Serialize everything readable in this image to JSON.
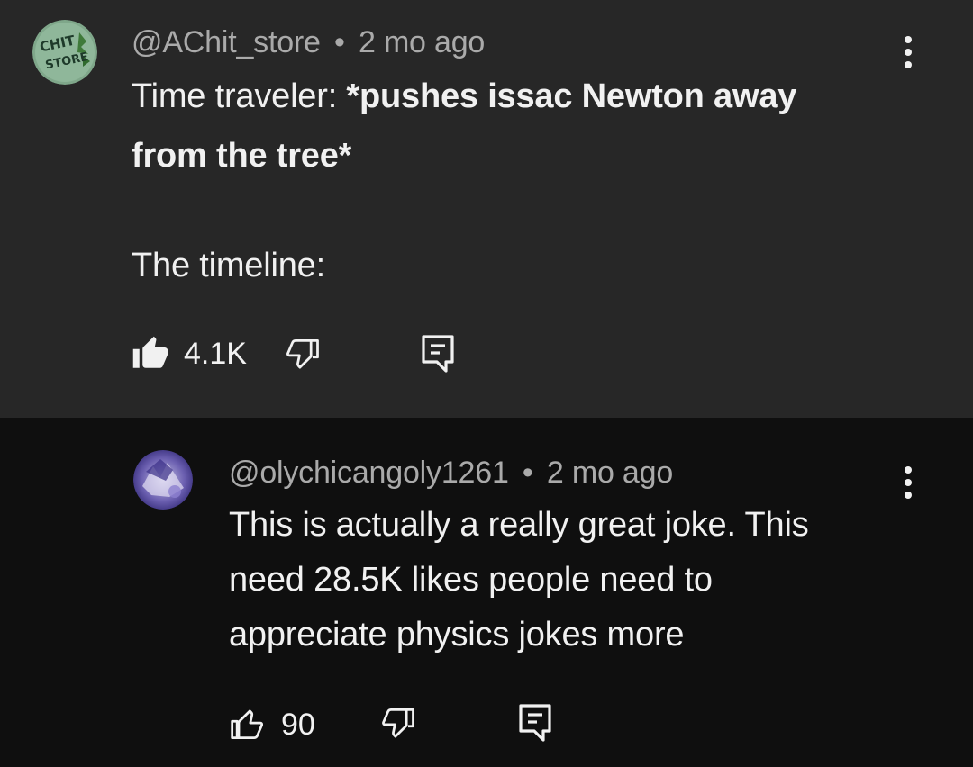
{
  "comments": [
    {
      "author": "@AChit_store",
      "separator": "•",
      "time": "2 mo ago",
      "avatar_text_line1": "CHIT",
      "avatar_text_line2": "STORE",
      "text_line1_plain": "Time traveler: ",
      "text_line1_bold": "*pushes issac Newton away",
      "text_line2_bold": "from the tree*",
      "text_line3": "The timeline:",
      "likes": "4.1K",
      "like_icon": "thumbs-up-filled-icon",
      "dislike_icon": "thumbs-down-outline-icon",
      "reply_icon": "reply-comment-icon",
      "menu_icon": "more-vertical-icon"
    },
    {
      "author": "@olychicangoly1261",
      "separator": "•",
      "time": "2 mo ago",
      "text_line1": "This is actually a really great joke. This",
      "text_line2": "need 28.5K likes people need to",
      "text_line3": "appreciate physics jokes more",
      "likes": "90",
      "like_icon": "thumbs-up-outline-icon",
      "dislike_icon": "thumbs-down-outline-icon",
      "reply_icon": "reply-comment-icon",
      "menu_icon": "more-vertical-icon"
    }
  ],
  "colors": {
    "top_comment_bg": "#272727",
    "reply_bg": "#0f0f0f",
    "text_primary": "#f1f1f1",
    "text_secondary": "#aaaaaa"
  }
}
